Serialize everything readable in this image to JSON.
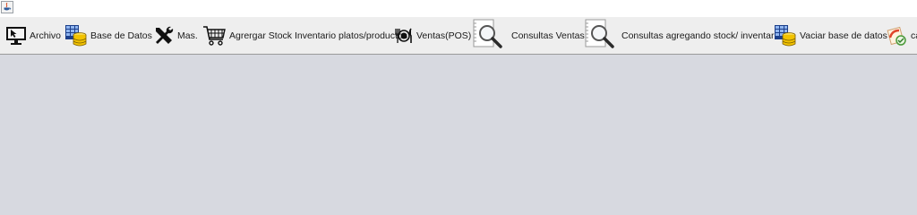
{
  "window": {
    "icon": "java-cup-icon"
  },
  "toolbar": {
    "items": [
      {
        "label": "Archivo",
        "icon": "monitor-icon"
      },
      {
        "label": "Base de Datos",
        "icon": "database-icon"
      },
      {
        "label": "Mas.",
        "icon": "tools-icon"
      },
      {
        "label": "Agrergar Stock Inventario platos/productos",
        "icon": "cart-icon"
      },
      {
        "label": "Ventas(POS)",
        "icon": "dining-icon"
      },
      {
        "label": "Consultas Ventas",
        "icon": "magnifier-document-icon"
      },
      {
        "label": "Consultas agregando stock/ inventario",
        "icon": "magnifier-document-icon"
      },
      {
        "label": "Vaciar base de datos",
        "icon": "database-icon"
      },
      {
        "label": "ca",
        "icon": "refresh-icon"
      }
    ]
  },
  "colors": {
    "desktop": "#d7d9e0",
    "toolbar": "#eeeeee",
    "database_accent": "#f2c200"
  }
}
